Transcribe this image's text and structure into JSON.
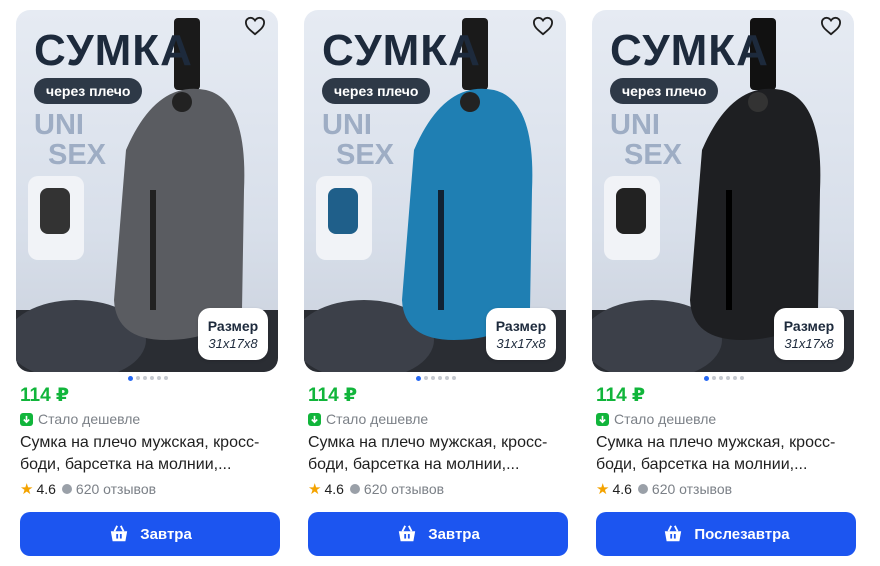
{
  "products": [
    {
      "image": {
        "headline": "СУМКА",
        "chip": "через плечо",
        "unisex_line1": "UNI",
        "unisex_line2": "SEX",
        "size_title": "Размер",
        "size_value": "31x17x8",
        "bag_color": "#5a5c61"
      },
      "price": "114 ₽",
      "badge": "Стало дешевле",
      "title_line1": "Сумка на плечо мужская, кросс-",
      "title_line2": "боди, барсетка на молнии,...",
      "rating": "4.6",
      "reviews": "620 отзывов",
      "button": "Завтра"
    },
    {
      "image": {
        "headline": "СУМКА",
        "chip": "через плечо",
        "unisex_line1": "UNI",
        "unisex_line2": "SEX",
        "size_title": "Размер",
        "size_value": "31x17x8",
        "bag_color": "#1f7fb3"
      },
      "price": "114 ₽",
      "badge": "Стало дешевле",
      "title_line1": "Сумка на плечо мужская, кросс-",
      "title_line2": "боди, барсетка на молнии,...",
      "rating": "4.6",
      "reviews": "620 отзывов",
      "button": "Завтра"
    },
    {
      "image": {
        "headline": "СУМКА",
        "chip": "через плечо",
        "unisex_line1": "UNI",
        "unisex_line2": "SEX",
        "size_title": "Размер",
        "size_value": "31x17x8",
        "bag_color": "#1e1f22"
      },
      "price": "114 ₽",
      "badge": "Стало дешевле",
      "title_line1": "Сумка на плечо мужская, кросс-",
      "title_line2": "боди, барсетка на молнии,...",
      "rating": "4.6",
      "reviews": "620 отзывов",
      "button": "Послезавтра"
    }
  ],
  "colors": {
    "price": "#11b53b",
    "button": "#1c55f0",
    "star": "#f4a300"
  },
  "icons": {
    "favorite": "heart-icon",
    "badge": "price-down-icon",
    "rating": "star-icon",
    "reviews": "chat-bubble-icon",
    "button": "basket-icon"
  }
}
